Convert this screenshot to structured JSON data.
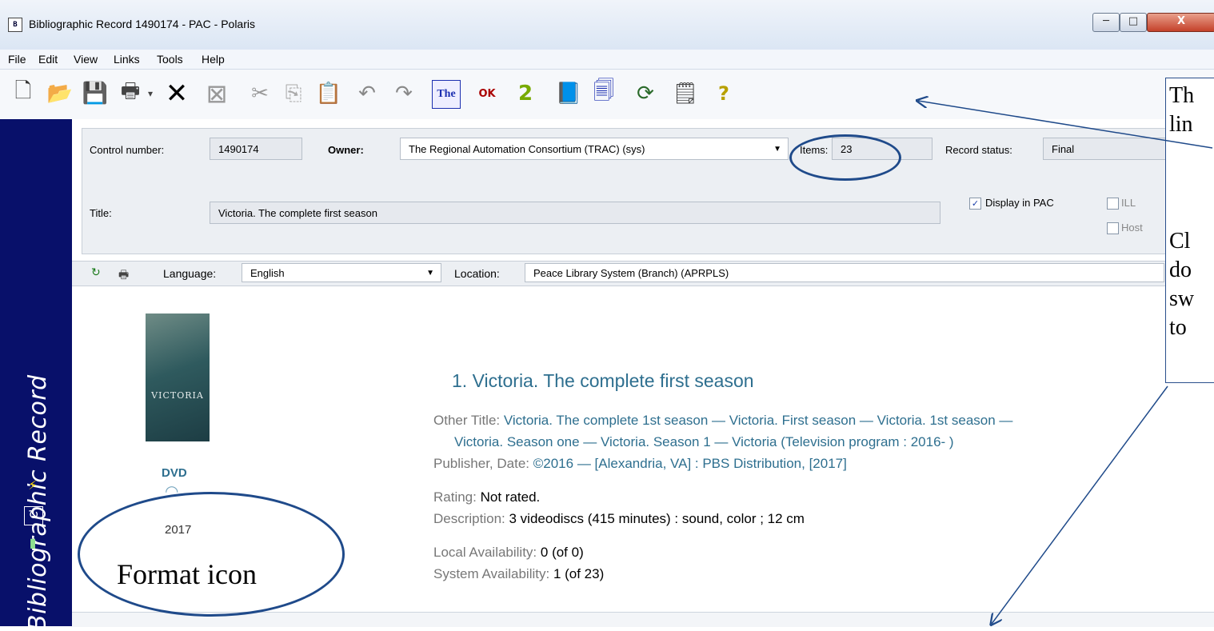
{
  "window": {
    "title": "Bibliographic Record 1490174 - PAC - Polaris",
    "app_icon_glyph": "B",
    "minimize": "─",
    "maximize": "□",
    "close": "X"
  },
  "menu": [
    "File",
    "Edit",
    "View",
    "Links",
    "Tools",
    "Help"
  ],
  "toolbar_icons": [
    "new-icon",
    "open-icon",
    "save-icon",
    "print-icon",
    "dropdown-icon",
    "delete-icon",
    "delete-disabled-icon",
    "cut-icon",
    "copy-icon",
    "paste-icon",
    "undo-icon",
    "redo-icon",
    "thesaurus-icon",
    "validate-ok-icon",
    "spellcheck-icon",
    "book-icon",
    "template-icon",
    "refresh-icon",
    "properties-icon",
    "help-icon"
  ],
  "sidebar": {
    "title": "Bibliographic Record"
  },
  "header": {
    "control_number_label": "Control number:",
    "control_number": "1490174",
    "owner_label": "Owner:",
    "owner": "The Regional Automation Consortium (TRAC) (sys)",
    "items_label": "Items:",
    "items": "23",
    "record_status_label": "Record status:",
    "record_status": "Final",
    "title_label": "Title:",
    "title": "Victoria. The complete first season",
    "display_in_pac": "Display in PAC",
    "ill": "ILL",
    "host": "Host"
  },
  "lang_bar": {
    "language_label": "Language:",
    "language": "English",
    "location_label": "Location:",
    "location": "Peace Library System (Branch) (APRPLS)"
  },
  "record": {
    "cover_title": "VICTORIA",
    "format": "DVD",
    "year": "2017",
    "heading": "1. Victoria. The complete first season",
    "other_title_label": "Other Title:",
    "other_title_1": "Victoria. The complete 1st season — Victoria. First season — Victoria. 1st season —",
    "other_title_2": "Victoria. Season one — Victoria. Season 1 — Victoria (Television program : 2016- )",
    "publisher_label": "Publisher, Date:",
    "publisher": "©2016 — [Alexandria, VA] : PBS Distribution, [2017]",
    "rating_label": "Rating:",
    "rating": "Not rated.",
    "description_label": "Description:",
    "description": "3 videodiscs (415 minutes) : sound, color ; 12 cm",
    "local_label": "Local Availability:",
    "local": "0 (of 0)",
    "system_label": "System Availability:",
    "system": "1 (of 23)"
  },
  "callout": {
    "lines": [
      "Th",
      "lin",
      "",
      "Cl",
      "do",
      "sw",
      "to"
    ],
    "format_label": "Format icon"
  }
}
